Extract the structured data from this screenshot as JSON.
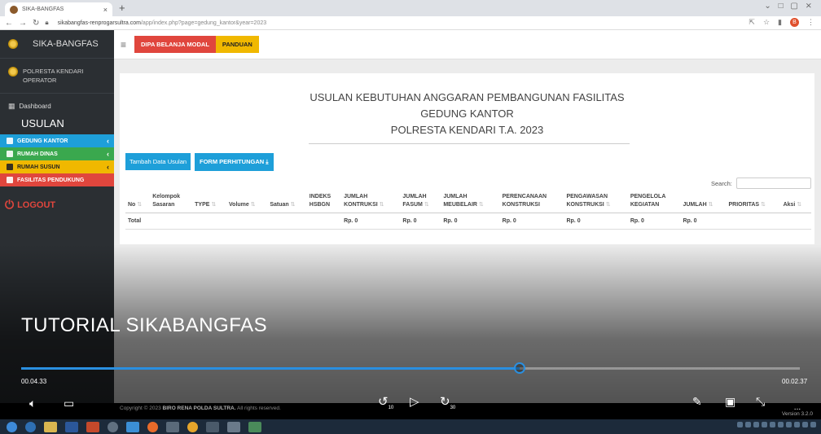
{
  "browser": {
    "tab_title": "SIKA-BANGFAS",
    "tab_close": "×",
    "new_tab": "+",
    "window_controls": "⌄ □ ▢ ⨯",
    "url_host": "sikabangfas-renprogarsultra.com",
    "url_path": "/app/index.php?page=gedung_kantor&year=2023",
    "profile_initial": "B"
  },
  "sidebar": {
    "brand": "SIKA-BANGFAS",
    "user_line1": "POLRESTA KENDARI",
    "user_line2": "OPERATOR",
    "dashboard": "Dashboard",
    "section": "USULAN",
    "items": [
      {
        "label": "GEDUNG KANTOR",
        "color": "#1e9fd9"
      },
      {
        "label": "RUMAH DINAS",
        "color": "#3aa84e"
      },
      {
        "label": "RUMAH SUSUN",
        "color": "#f0b800"
      },
      {
        "label": "FASILITAS PENDUKUNG",
        "color": "#e0463d"
      }
    ],
    "logout": "LOGOUT"
  },
  "topnav": {
    "btn_dipa": "DIPA BELANJA MODAL",
    "btn_panduan": "PANDUAN"
  },
  "page": {
    "title_line1": "USULAN KEBUTUHAN ANGGARAN PEMBANGUNAN FASILITAS",
    "title_line2": "GEDUNG KANTOR",
    "title_line3": "POLRESTA KENDARI T.A. 2023",
    "btn_add": "Tambah Data Usulan",
    "btn_form": "FORM PERHITUNGAN ⤓",
    "search_label": "Search:"
  },
  "table": {
    "headers": [
      [
        "No",
        ""
      ],
      [
        "Kelompok",
        "Sasaran"
      ],
      [
        "TYPE",
        ""
      ],
      [
        "Volume",
        ""
      ],
      [
        "Satuan",
        ""
      ],
      [
        "INDEKS",
        "HSBGN"
      ],
      [
        "JUMLAH",
        "KONTRUKSI"
      ],
      [
        "JUMLAH",
        "FASUM"
      ],
      [
        "JUMLAH",
        "MEUBELAIR"
      ],
      [
        "PERENCANAAN",
        "KONSTRUKSI"
      ],
      [
        "PENGAWASAN",
        "KONSTRUKSI"
      ],
      [
        "PENGELOLA",
        "KEGIATAN"
      ],
      [
        "JUMLAH",
        ""
      ],
      [
        "PRIORITAS",
        ""
      ],
      [
        "Aksi",
        ""
      ]
    ],
    "total_row": [
      "Total",
      "",
      "",
      "",
      "",
      "",
      "Rp. 0",
      "Rp. 0",
      "Rp. 0",
      "Rp. 0",
      "Rp. 0",
      "Rp. 0",
      "Rp. 0",
      "",
      ""
    ]
  },
  "footer": {
    "prefix": "Copyright © 2023",
    "org": "BIRO RENA POLDA SULTRA.",
    "suffix": "All rights reserved.",
    "version_line1": "...",
    "version_line2": "Version 3.2.0"
  },
  "video": {
    "title": "TUTORIAL SIKABANGFAS",
    "time_elapsed": "00.04.33",
    "time_remaining": "00.02.37",
    "progress_fraction": 0.64,
    "skip_back": "10",
    "skip_fwd": "30"
  }
}
